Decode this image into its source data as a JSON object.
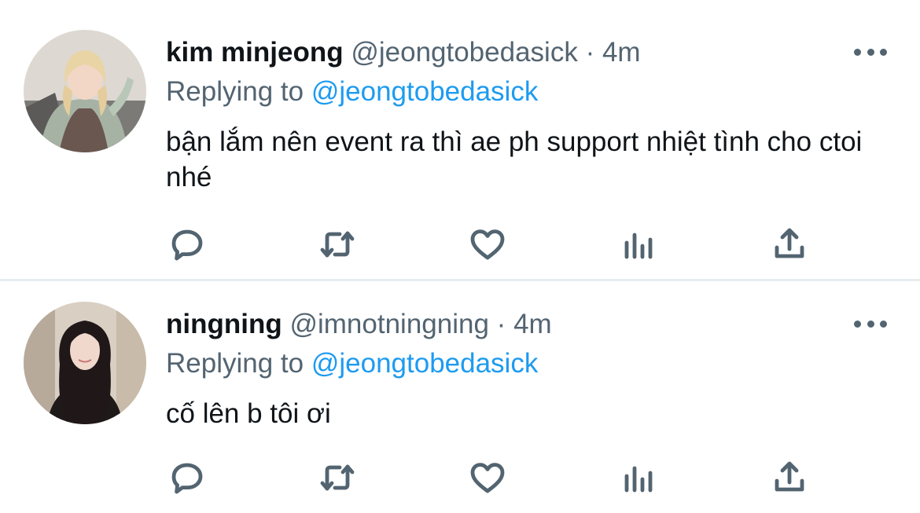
{
  "tweets": [
    {
      "display_name": "kim minjeong",
      "handle": "@jeongtobedasick",
      "separator": "·",
      "time": "4m",
      "replying_prefix": "Replying to",
      "replying_to": "@jeongtobedasick",
      "text": "bận lắm nên event ra thì ae ph support nhiệt tình cho ctoi nhé",
      "avatar_icon": "avatar-photo-blonde",
      "more_icon": "more-dots-icon"
    },
    {
      "display_name": "ningning",
      "handle": "@imnotningning",
      "separator": "·",
      "time": "4m",
      "replying_prefix": "Replying to",
      "replying_to": "@jeongtobedasick",
      "text": "cố lên b tôi ơi",
      "avatar_icon": "avatar-photo-dark-hair",
      "more_icon": "more-dots-icon"
    }
  ],
  "action_icons": [
    "reply-icon",
    "retweet-icon",
    "like-icon",
    "analytics-icon",
    "share-icon"
  ],
  "colors": {
    "link": "#1d9bf0",
    "secondary_text": "#536471",
    "primary_text": "#0f1419",
    "divider": "#e6ecf0"
  }
}
